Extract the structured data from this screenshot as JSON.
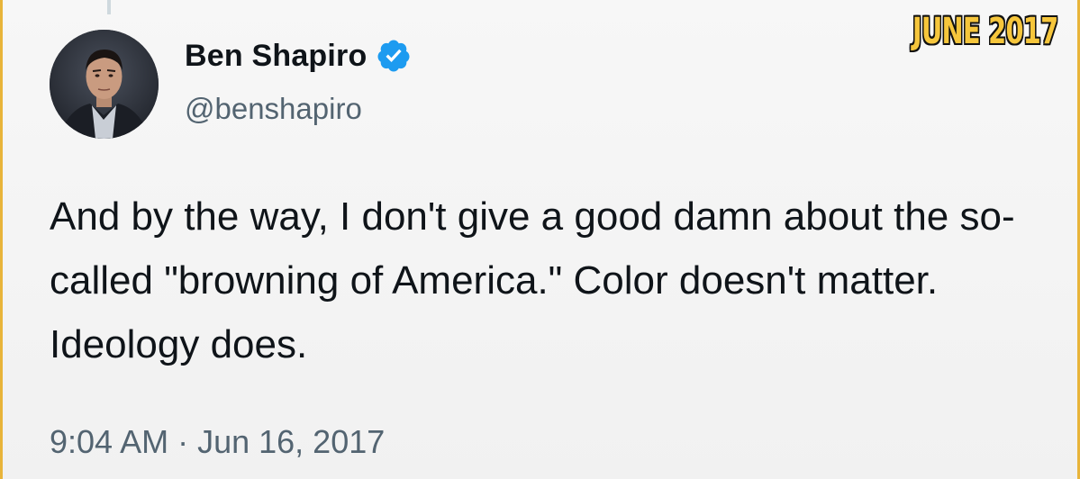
{
  "tweet": {
    "display_name": "Ben Shapiro",
    "handle": "@benshapiro",
    "verified": true,
    "text": "And by the way, I don't give a good damn about the so-called \"browning of America.\" Color doesn't matter. Ideology does.",
    "timestamp": "9:04 AM · Jun 16, 2017"
  },
  "overlay": {
    "date_badge": "JUNE 2017"
  },
  "icons": {
    "verified": "verified-badge-icon",
    "avatar": "profile-photo"
  },
  "colors": {
    "verified_blue": "#1d9bf0",
    "badge_yellow": "#f6c63c",
    "frame_border": "#e8b43a",
    "text_primary": "#0f1419",
    "text_secondary": "#536471"
  }
}
